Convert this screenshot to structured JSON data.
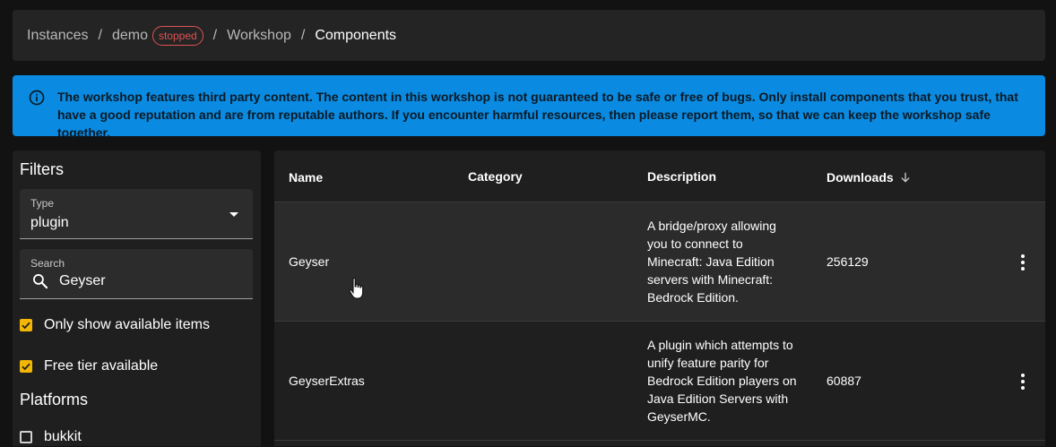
{
  "breadcrumb": {
    "items": [
      "Instances",
      "demo",
      "Workshop",
      "Components"
    ],
    "separator": "/",
    "status_badge": "stopped"
  },
  "alert": {
    "text": "The workshop features third party content. The content in this workshop is not guaranteed to be safe or free of bugs. Only install components that you trust, that have a good reputation and are from reputable authors. If you encounter harmful resources, then please report them, so that we can keep the workshop safe together."
  },
  "filters": {
    "title": "Filters",
    "type_label": "Type",
    "type_value": "plugin",
    "search_label": "Search",
    "search_value": "Geyser",
    "only_available_label": "Only show available items",
    "free_tier_label": "Free tier available",
    "platforms_title": "Platforms",
    "platform_bukkit": "bukkit"
  },
  "table": {
    "headers": {
      "name": "Name",
      "category": "Category",
      "description": "Description",
      "downloads": "Downloads"
    },
    "rows": [
      {
        "name": "Geyser",
        "category": "",
        "description": "A bridge/proxy allowing you to connect to Minecraft: Java Edition servers with Minecraft: Bedrock Edition.",
        "downloads": "256129"
      },
      {
        "name": "GeyserExtras",
        "category": "",
        "description": "A plugin which attempts to unify feature parity for Bedrock Edition players on Java Edition Servers with GeyserMC.",
        "downloads": "60887"
      }
    ]
  },
  "colors": {
    "accent_info": "#0a8ae0",
    "checkbox_on": "#f2b705",
    "badge_stopped": "#e05252"
  },
  "icons": {
    "alert": "info-circle-icon",
    "search": "magnifier-icon",
    "sort": "arrow-down-icon",
    "row_menu": "more-vertical-icon"
  }
}
